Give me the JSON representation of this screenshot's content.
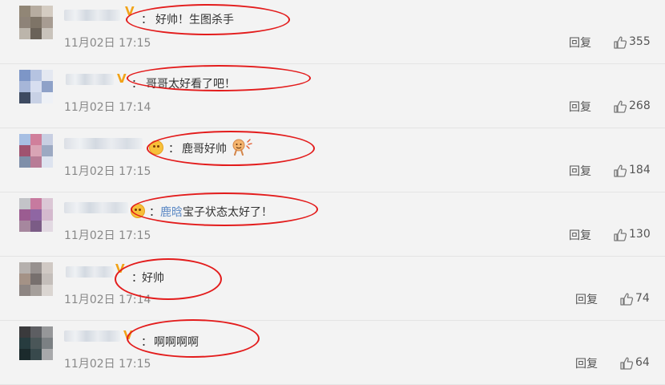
{
  "comments": [
    {
      "segments": [
        {
          "text": "好帅！生图杀手",
          "mention": false
        }
      ],
      "time": "11月02日 17:15",
      "reply_label": "回复",
      "likes": "355",
      "badge": "vip",
      "sticker": null
    },
    {
      "segments": [
        {
          "text": "哥哥太好看了吧！",
          "mention": false
        }
      ],
      "time": "11月02日 17:14",
      "reply_label": "回复",
      "likes": "268",
      "badge": "vip",
      "sticker": null
    },
    {
      "segments": [
        {
          "text": "鹿哥好帅",
          "mention": false
        }
      ],
      "time": "11月02日 17:15",
      "reply_label": "回复",
      "likes": "184",
      "badge": "emoji",
      "sticker": "sticker-emoji"
    },
    {
      "segments": [
        {
          "text": "鹿晗",
          "mention": true
        },
        {
          "text": "宝子状态太好了！",
          "mention": false
        }
      ],
      "time": "11月02日 17:15",
      "reply_label": "回复",
      "likes": "130",
      "badge": "emoji",
      "sticker": null
    },
    {
      "segments": [
        {
          "text": "好帅",
          "mention": false
        }
      ],
      "time": "11月02日 17:14",
      "reply_label": "回复",
      "likes": "74",
      "badge": "vip",
      "sticker": null
    },
    {
      "segments": [
        {
          "text": "啊啊啊啊",
          "mention": false
        }
      ],
      "time": "11月02日 17:15",
      "reply_label": "回复",
      "likes": "64",
      "badge": "vip",
      "sticker": null
    }
  ],
  "colors": {
    "background": "#f3f3f3",
    "annotation_circle": "#e31c1c",
    "vip_badge": "#f1a318",
    "mention_link": "#5b88c4",
    "muted_text": "#888888"
  },
  "icons": {
    "like": "thumbs-up-icon",
    "vip": "vip-v-icon",
    "emoji": "emoji-badge-icon"
  }
}
